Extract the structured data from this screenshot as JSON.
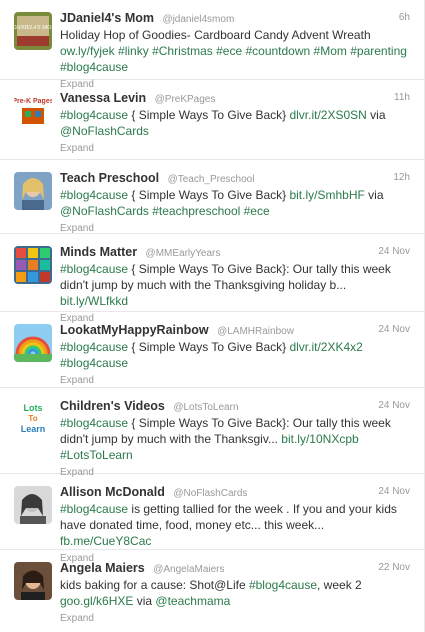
{
  "tweets": [
    {
      "avatar": "avatar-jdaniel4s-mom",
      "fullname": "JDaniel4's Mom",
      "username": "@jdaniel4smom",
      "time": "6h",
      "text_parts": [
        {
          "t": "Holiday Hop of Goodies- Cardboard Candy Advent Wreath ",
          "link": false
        },
        {
          "t": "ow.ly/fyjek",
          "link": true
        },
        {
          "t": " ",
          "link": false
        },
        {
          "t": "#linky",
          "link": true
        },
        {
          "t": " ",
          "link": false
        },
        {
          "t": "#Christmas",
          "link": true
        },
        {
          "t": " ",
          "link": false
        },
        {
          "t": "#ece",
          "link": true
        },
        {
          "t": " ",
          "link": false
        },
        {
          "t": "#countdown",
          "link": true
        },
        {
          "t": " ",
          "link": false
        },
        {
          "t": "#Mom",
          "link": true
        },
        {
          "t": " ",
          "link": false
        },
        {
          "t": "#parenting",
          "link": true
        },
        {
          "t": " ",
          "link": false
        },
        {
          "t": "#blog4cause",
          "link": true
        }
      ],
      "expand": "Expand"
    },
    {
      "avatar": "avatar-prek-pages",
      "fullname": "Vanessa Levin",
      "username": "@PreKPages",
      "time": "11h",
      "text_parts": [
        {
          "t": "#blog4cause",
          "link": true
        },
        {
          "t": " { Simple Ways To Give Back} ",
          "link": false
        },
        {
          "t": "dlvr.it/2XS0SN",
          "link": true
        },
        {
          "t": " via ",
          "link": false
        },
        {
          "t": "@NoFlashCards",
          "link": true
        }
      ],
      "expand": "Expand"
    },
    {
      "avatar": "avatar-teach-preschool",
      "fullname": "Teach Preschool",
      "username": "@Teach_Preschool",
      "time": "12h",
      "text_parts": [
        {
          "t": "#blog4cause",
          "link": true
        },
        {
          "t": " { Simple Ways To Give Back} ",
          "link": false
        },
        {
          "t": "bit.ly/SmhbHF",
          "link": true
        },
        {
          "t": " via ",
          "link": false
        },
        {
          "t": "@NoFlashCards",
          "link": true
        },
        {
          "t": " ",
          "link": false
        },
        {
          "t": "#teachpreschool",
          "link": true
        },
        {
          "t": " ",
          "link": false
        },
        {
          "t": "#ece",
          "link": true
        }
      ],
      "expand": "Expand"
    },
    {
      "avatar": "avatar-minds-matter",
      "fullname": "Minds Matter",
      "username": "@MMEarlyYears",
      "time": "24 Nov",
      "text_parts": [
        {
          "t": "#blog4cause",
          "link": true
        },
        {
          "t": " { Simple Ways To Give Back}: Our tally this week didn't jump by much with the Thanksgiving holiday b... ",
          "link": false
        },
        {
          "t": "bit.ly/WLfkkd",
          "link": true
        }
      ],
      "expand": "Expand"
    },
    {
      "avatar": "avatar-rainbow",
      "fullname": "LookatMyHappyRainbow",
      "username": "@LAMHRainbow",
      "time": "24 Nov",
      "text_parts": [
        {
          "t": "#blog4cause",
          "link": true
        },
        {
          "t": " { Simple Ways To Give Back} ",
          "link": false
        },
        {
          "t": "dlvr.it/2XK4x2",
          "link": true
        },
        {
          "t": " ",
          "link": false
        },
        {
          "t": "#blog4cause",
          "link": true
        }
      ],
      "expand": "Expand"
    },
    {
      "avatar": "avatar-lots-to-learn",
      "fullname": "Children's Videos",
      "username": "@LotsToLearn",
      "time": "24 Nov",
      "text_parts": [
        {
          "t": "#blog4cause",
          "link": true
        },
        {
          "t": " { Simple Ways To Give Back}: Our tally this week didn't jump by much with the Thanksgiv... ",
          "link": false
        },
        {
          "t": "bit.ly/10NXcpb",
          "link": true
        },
        {
          "t": " ",
          "link": false
        },
        {
          "t": "#LotsToLearn",
          "link": true
        }
      ],
      "expand": "Expand"
    },
    {
      "avatar": "avatar-allison-mcdonald",
      "fullname": "Allison McDonald",
      "username": "@NoFlashCards",
      "time": "24 Nov",
      "text_parts": [
        {
          "t": "#blog4cause",
          "link": true
        },
        {
          "t": " is getting tallied for the week . If you and your kids have donated time, food, money etc... this week... ",
          "link": false
        },
        {
          "t": "fb.me/CueY8Cac",
          "link": true
        }
      ],
      "expand": "Expand"
    },
    {
      "avatar": "avatar-angela-maiers",
      "fullname": "Angela Maiers",
      "username": "@AngelaMaiers",
      "time": "22 Nov",
      "text_parts": [
        {
          "t": "kids baking for a cause: Shot@Life ",
          "link": false
        },
        {
          "t": "#blog4cause",
          "link": true
        },
        {
          "t": ", week 2 ",
          "link": false
        },
        {
          "t": "goo.gl/k6HXE",
          "link": true
        },
        {
          "t": " via ",
          "link": false
        },
        {
          "t": "@teachmama",
          "link": true
        }
      ],
      "expand": "Expand"
    }
  ],
  "avatar_texts": {
    "jdaniel_logo": "JDANIEL4'S MOM",
    "prek_logo": "Pre-K Pages",
    "ltl_logo": [
      "Lots",
      "To",
      "Learn"
    ]
  },
  "colors": {
    "link": "#2b7a4b",
    "muted": "#999999",
    "text": "#333333",
    "divider": "#e8e8e8"
  }
}
